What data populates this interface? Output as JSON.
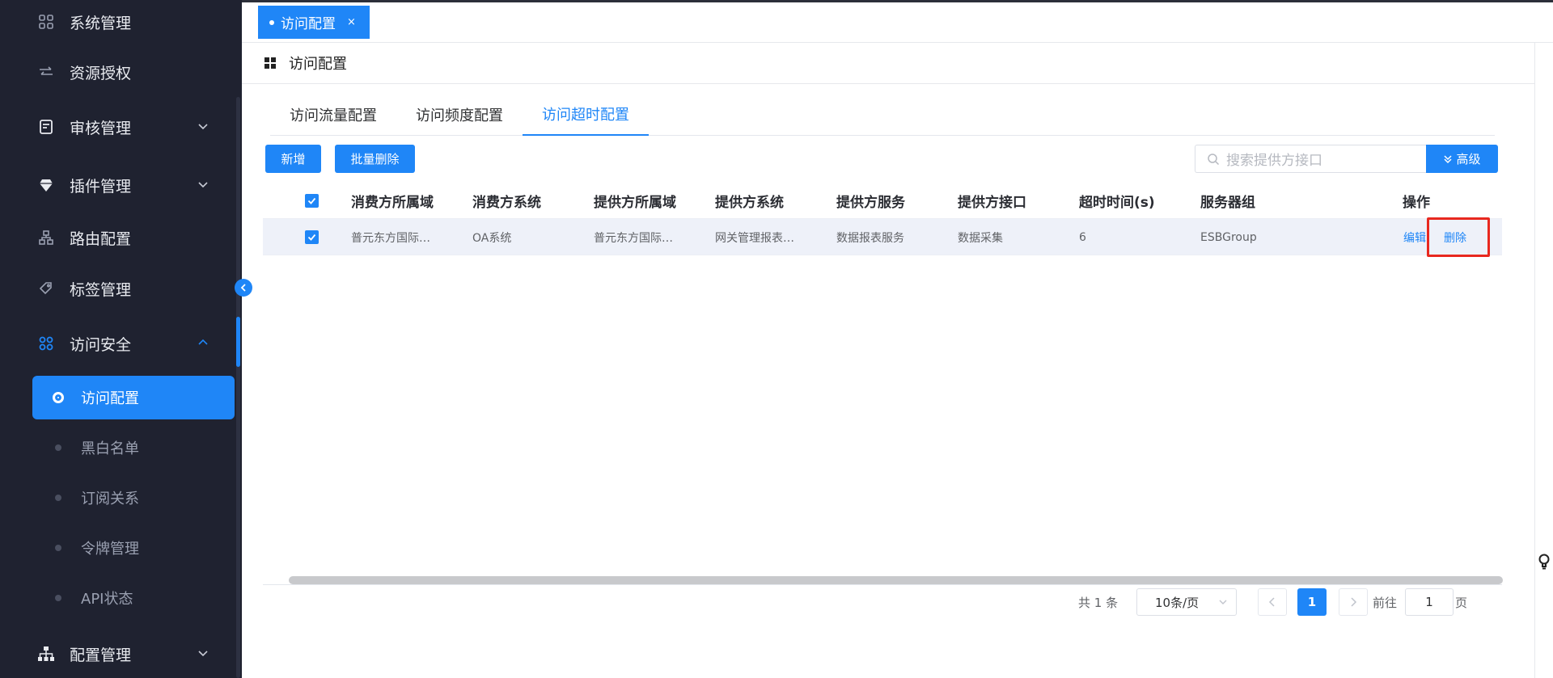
{
  "sidebar": {
    "items": [
      {
        "label": "系统管理",
        "icon": "grid-icon"
      },
      {
        "label": "资源授权",
        "icon": "arrows-icon"
      },
      {
        "label": "审核管理",
        "icon": "audit-icon"
      },
      {
        "label": "插件管理",
        "icon": "diamond-icon"
      },
      {
        "label": "路由配置",
        "icon": "network-icon"
      },
      {
        "label": "标签管理",
        "icon": "tag-icon"
      },
      {
        "label": "访问安全",
        "icon": "apps-icon"
      },
      {
        "label": "配置管理",
        "icon": "tree-icon"
      }
    ],
    "sub_items": [
      {
        "label": "访问配置"
      },
      {
        "label": "黑白名单"
      },
      {
        "label": "订阅关系"
      },
      {
        "label": "令牌管理"
      },
      {
        "label": "API状态"
      }
    ]
  },
  "open_tab": {
    "label": "访问配置",
    "close": "×"
  },
  "page": {
    "title": "访问配置"
  },
  "sub_tabs": [
    "访问流量配置",
    "访问频度配置",
    "访问超时配置"
  ],
  "toolbar": {
    "add_label": "新增",
    "batch_delete_label": "批量删除",
    "search_placeholder": "搜索提供方接口",
    "advanced_label": "高级"
  },
  "table": {
    "headers": [
      "消费方所属域",
      "消费方系统",
      "提供方所属域",
      "提供方系统",
      "提供方服务",
      "提供方接口",
      "超时时间(s)",
      "服务器组",
      "操作"
    ],
    "rows": [
      {
        "cells": [
          "普元东方国际…",
          "OA系统",
          "普元东方国际…",
          "网关管理报表…",
          "数据报表服务",
          "数据采集",
          "6",
          "ESBGroup"
        ],
        "edit": "编辑",
        "delete": "删除"
      }
    ]
  },
  "pagination": {
    "total": "共 1 条",
    "page_size": "10条/页",
    "current_page": "1",
    "goto_label": "前往",
    "goto_value": "1",
    "page_suffix": "页"
  },
  "colors": {
    "primary": "#1f86f7",
    "sidebar_bg": "#1f2230",
    "highlight": "#e8281f"
  }
}
